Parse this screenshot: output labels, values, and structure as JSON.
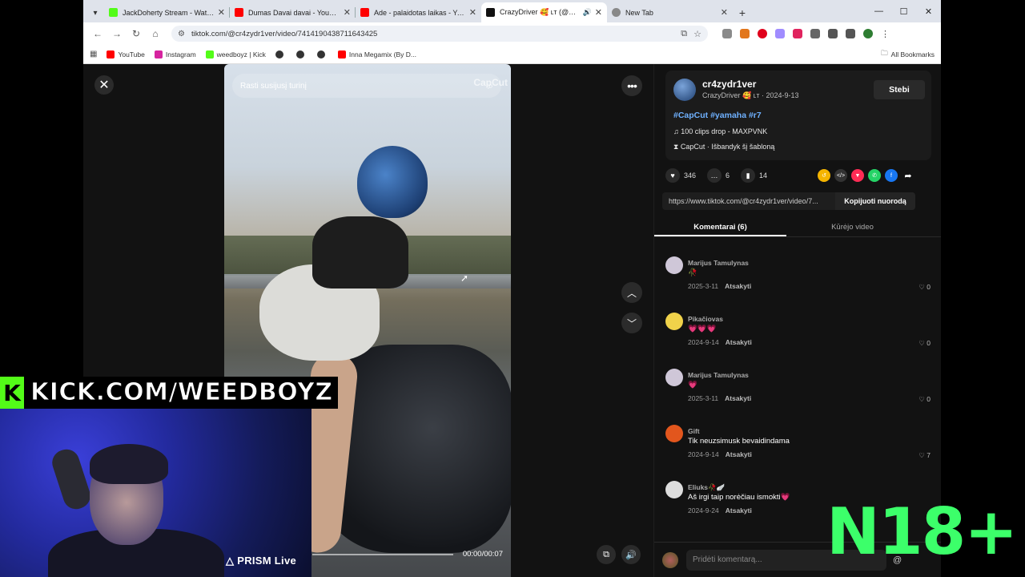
{
  "browser": {
    "tabs": [
      {
        "title": "JackDoherty Stream - Watch Li",
        "fav_color": "#53fc18",
        "active": false
      },
      {
        "title": "Dumas Davai davai - YouTube",
        "fav_color": "#ff0000",
        "active": false
      },
      {
        "title": "Ade - palaidotas laikas - YouTu",
        "fav_color": "#ff0000",
        "active": false
      },
      {
        "title": "CrazyDriver 🥰 ʟᴛ (@cr4zydr",
        "fav_color": "#111111",
        "active": true
      },
      {
        "title": "New Tab",
        "fav_color": "#888888",
        "active": false
      }
    ],
    "url": "tiktok.com/@cr4zydr1ver/video/7414190438711643425",
    "bookmarks": [
      {
        "label": "YouTube",
        "color": "#ff0000"
      },
      {
        "label": "Instagram",
        "color": "#d6249f"
      },
      {
        "label": "weedboyz | Kick",
        "color": "#53fc18"
      },
      {
        "label": "",
        "color": "#333333"
      },
      {
        "label": "",
        "color": "#333333"
      },
      {
        "label": "",
        "color": "#333333"
      },
      {
        "label": "Inna Megamix (By D...",
        "color": "#ff0000"
      }
    ],
    "all_bookmarks": "All Bookmarks"
  },
  "video": {
    "search_placeholder": "Rasti susijusį turinį",
    "watermark": "CapCut",
    "timecode": "00:00/00:07"
  },
  "panel": {
    "author_handle": "cr4zydr1ver",
    "author_meta": "CrazyDriver 🥰 ʟᴛ · 2024-9-13",
    "follow_label": "Stebi",
    "tags": "#CapCut #yamaha #r7",
    "music": "100 clips drop - MAXPVNK",
    "template": "CapCut · Išbandyk šį šabloną",
    "likes": "346",
    "comments_count": "6",
    "saves": "14",
    "link": "https://www.tiktok.com/@cr4zydr1ver/video/7...",
    "copy_label": "Kopijuoti nuorodą",
    "tab_comments": "Komentarai (6)",
    "tab_creator": "Kūrėjo video",
    "add_comment_placeholder": "Pridėti komentarą...",
    "comment_list": [
      {
        "name": "Marijus Tamulynas",
        "text": "🥀",
        "date": "2025-3-11",
        "likes": "0",
        "avatar": "#cfc7d8"
      },
      {
        "name": "Pikačiovas",
        "text": "💗💗💗",
        "date": "2024-9-14",
        "likes": "0",
        "avatar": "#f0d24a"
      },
      {
        "name": "Marijus Tamulynas",
        "text": "💗",
        "date": "2025-3-11",
        "likes": "0",
        "avatar": "#cfc7d8"
      },
      {
        "name": "Gift",
        "text": "Tik neuzsimusk bevaidindama",
        "date": "2024-9-14",
        "likes": "7",
        "avatar": "#e2561d"
      },
      {
        "name": "Eliuks🥀🪽",
        "text": "Aš irgi taip norėčiau ismokti💗",
        "date": "2024-9-24",
        "likes": "",
        "avatar": "#dddddd"
      }
    ],
    "reply_label": "Atsakyti"
  },
  "overlay": {
    "kick_logo": "K",
    "kick_text": "KICK.COM/WEEDBOYZ",
    "prism": "PRISM Live",
    "rating": "N18+"
  }
}
